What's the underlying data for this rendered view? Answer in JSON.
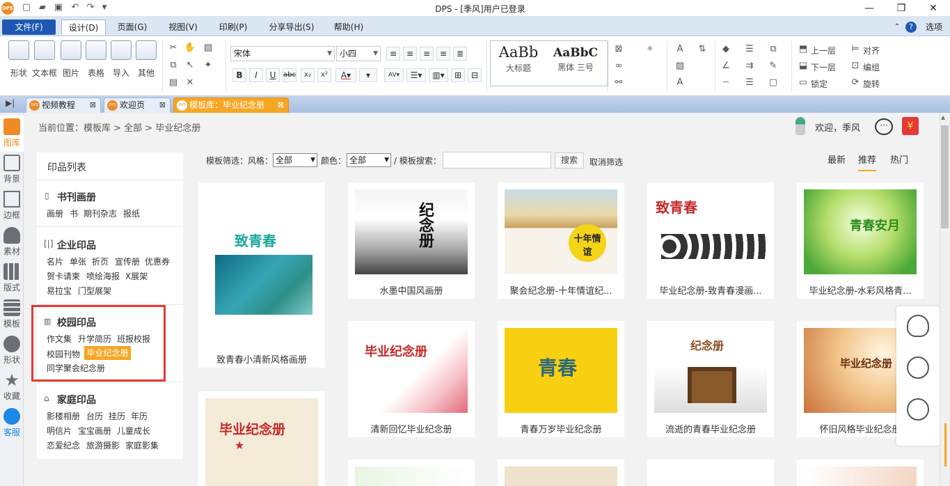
{
  "titlebar": {
    "app_logo": "DPS",
    "title": "DPS - [季风]用户已登录",
    "options": "选项",
    "qa_icons": [
      "new-icon",
      "open-icon",
      "save-icon",
      "undo-icon",
      "redo-icon",
      "dropdown-icon"
    ]
  },
  "menu": {
    "file": "文件(F)",
    "design": "设计(D)",
    "page": "页面(G)",
    "view": "视图(V)",
    "print": "印刷(P)",
    "share": "分享导出(S)",
    "help": "帮助(H)"
  },
  "ribbon": {
    "shape": "形状",
    "textbox": "文本框",
    "picture": "图片",
    "table": "表格",
    "import": "导入",
    "other": "其他",
    "font": "宋体",
    "size": "小四",
    "style_sample": "AaBb",
    "style_sample2": "AaBbC",
    "style_big": "大标题",
    "style_heiti": "黑体",
    "style_sanhao": "三号",
    "layer_up": "上一层",
    "layer_down": "下一层",
    "lock": "锁定",
    "align": "对齐",
    "group": "编组",
    "rotate": "旋转"
  },
  "tabs": [
    {
      "label": "视频教程"
    },
    {
      "label": "欢迎页"
    },
    {
      "label": "模板库：毕业纪念册"
    }
  ],
  "sidebar": [
    "图库",
    "背景",
    "边框",
    "素材",
    "版式",
    "模板",
    "形状",
    "收藏",
    "客服"
  ],
  "header": {
    "breadcrumb": "当前位置：模板库 > 全部 > 毕业纪念册",
    "welcome": "欢迎，季风"
  },
  "panel": {
    "title": "印品列表",
    "cat1": {
      "name": "书刊画册",
      "items": [
        "画册",
        "书",
        "期刊杂志",
        "报纸"
      ]
    },
    "cat2": {
      "name": "企业印品",
      "items": [
        "名片",
        "单张",
        "折页",
        "宣传册",
        "优惠券",
        "贺卡请柬",
        "喷绘海报",
        "X展架",
        "易拉宝",
        "门型展架"
      ]
    },
    "cat3": {
      "name": "校园印品",
      "items": [
        "作文集",
        "升学简历",
        "班报校报",
        "校园刊物",
        "毕业纪念册",
        "同学聚会纪念册"
      ]
    },
    "cat4": {
      "name": "家庭印品",
      "items": [
        "影楼相册",
        "台历",
        "挂历",
        "年历",
        "明信片",
        "宝宝画册",
        "儿童成长",
        "恋爱纪念",
        "旅游摄影",
        "家庭影集"
      ]
    }
  },
  "filter": {
    "label_style": "模板筛选：风格：",
    "style_value": "全部",
    "label_color": "颜色：",
    "color_value": "全部",
    "label_search": "/ 模板搜索：",
    "search_btn": "搜索",
    "cancel": "取消筛选"
  },
  "sort": {
    "newest": "最新",
    "recommend": "推荐",
    "hot": "热门"
  },
  "cards": [
    {
      "title": "致青春小清新风格画册",
      "thumb_text": "致青春"
    },
    {
      "title": "水墨中国风画册",
      "thumb_text": "纪念册"
    },
    {
      "title": "聚会纪念册-十年情谊纪...",
      "thumb_text": "十年情谊"
    },
    {
      "title": "毕业纪念册-致青春漫画...",
      "thumb_text": "致青春"
    },
    {
      "title": "毕业纪念册-水彩风格青...",
      "thumb_text": "青春安月"
    },
    {
      "title": "清新回忆毕业纪念册",
      "thumb_text": "毕业纪念册"
    },
    {
      "title": "青春万岁毕业纪念册",
      "thumb_text": "青春"
    },
    {
      "title": "流逝的青春毕业纪念册",
      "thumb_text": "纪念册"
    },
    {
      "title": "怀旧风格毕业纪念册",
      "thumb_text": "毕业纪念册"
    },
    {
      "title": "",
      "thumb_text": "毕业纪念册"
    }
  ],
  "colors": {
    "accent": "#f5a623",
    "file_menu": "#1f58b3",
    "highlight_box": "#e53935"
  }
}
